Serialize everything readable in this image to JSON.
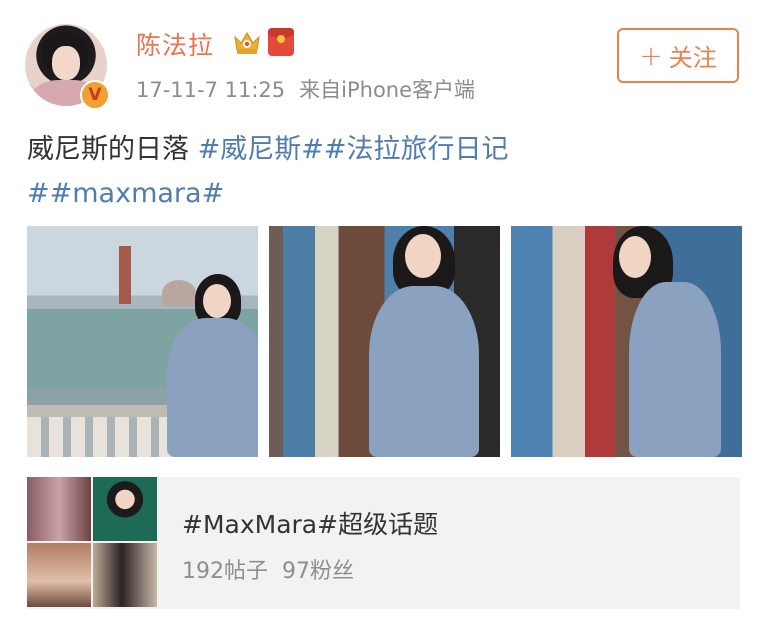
{
  "post": {
    "author": "陈法拉",
    "time": "17-11-7 11:25",
    "source": "来自iPhone客户端",
    "follow_label": "关注",
    "follow_plus": "+",
    "text_plain": "威尼斯的日落 ",
    "hashtag1": "#威尼斯#",
    "hashtag2": "#法拉旅行日记",
    "hashtag3": "##maxmara#"
  },
  "topic": {
    "title": "#MaxMara#超级话题",
    "posts": "192帖子",
    "fans": "97粉丝"
  },
  "colors": {
    "name": "#eb7350",
    "hashtag": "#507daf",
    "follow": "#e8834f"
  },
  "icons": {
    "verified": "v-badge",
    "crown": "crown-icon",
    "redpacket": "red-packet-icon"
  }
}
